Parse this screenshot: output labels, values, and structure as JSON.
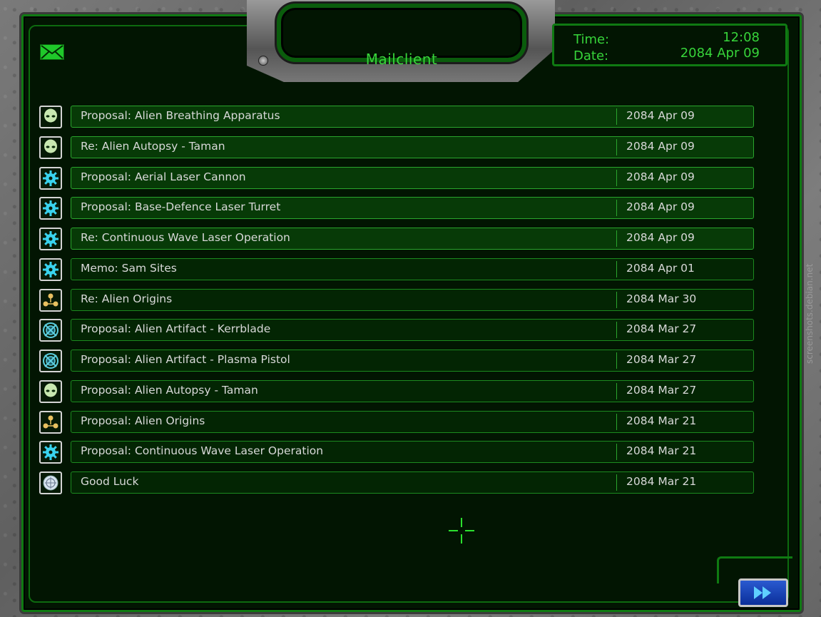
{
  "window": {
    "title": "Mailclient"
  },
  "clock": {
    "time_label": "Time:",
    "time_value": "12:08",
    "date_label": "Date:",
    "date_value": "2084 Apr 09"
  },
  "colors": {
    "accent": "#37d43a",
    "panel": "#021502",
    "row_text": "#d8d8d8"
  },
  "compose_icon": "envelope-icon",
  "messages": [
    {
      "icon": "alien-head-icon",
      "subject": "Proposal: Alien Breathing Apparatus",
      "date": "2084 Apr 09",
      "unread": true
    },
    {
      "icon": "alien-head-icon",
      "subject": "Re: Alien Autopsy - Taman",
      "date": "2084 Apr 09",
      "unread": true
    },
    {
      "icon": "gear-icon",
      "subject": "Proposal: Aerial Laser Cannon",
      "date": "2084 Apr 09",
      "unread": true
    },
    {
      "icon": "gear-icon",
      "subject": "Proposal: Base-Defence Laser Turret",
      "date": "2084 Apr 09",
      "unread": true
    },
    {
      "icon": "gear-icon",
      "subject": "Re: Continuous Wave Laser Operation",
      "date": "2084 Apr 09",
      "unread": true
    },
    {
      "icon": "gear-icon",
      "subject": "Memo: Sam Sites",
      "date": "2084 Apr 01",
      "unread": false
    },
    {
      "icon": "molecule-icon",
      "subject": "Re: Alien Origins",
      "date": "2084 Mar 30",
      "unread": false
    },
    {
      "icon": "artifact-icon",
      "subject": "Proposal: Alien Artifact - Kerrblade",
      "date": "2084 Mar 27",
      "unread": false
    },
    {
      "icon": "artifact-icon",
      "subject": "Proposal: Alien Artifact - Plasma Pistol",
      "date": "2084 Mar 27",
      "unread": false
    },
    {
      "icon": "alien-head-icon",
      "subject": "Proposal: Alien Autopsy - Taman",
      "date": "2084 Mar 27",
      "unread": false
    },
    {
      "icon": "molecule-icon",
      "subject": "Proposal: Alien Origins",
      "date": "2084 Mar 21",
      "unread": false
    },
    {
      "icon": "gear-icon",
      "subject": "Proposal: Continuous Wave Laser Operation",
      "date": "2084 Mar 21",
      "unread": false
    },
    {
      "icon": "globe-emblem-icon",
      "subject": "Good Luck",
      "date": "2084 Mar 21",
      "unread": false
    }
  ],
  "continue_button": {
    "icon": "fast-forward-icon"
  },
  "watermark": "screenshots.debian.net"
}
